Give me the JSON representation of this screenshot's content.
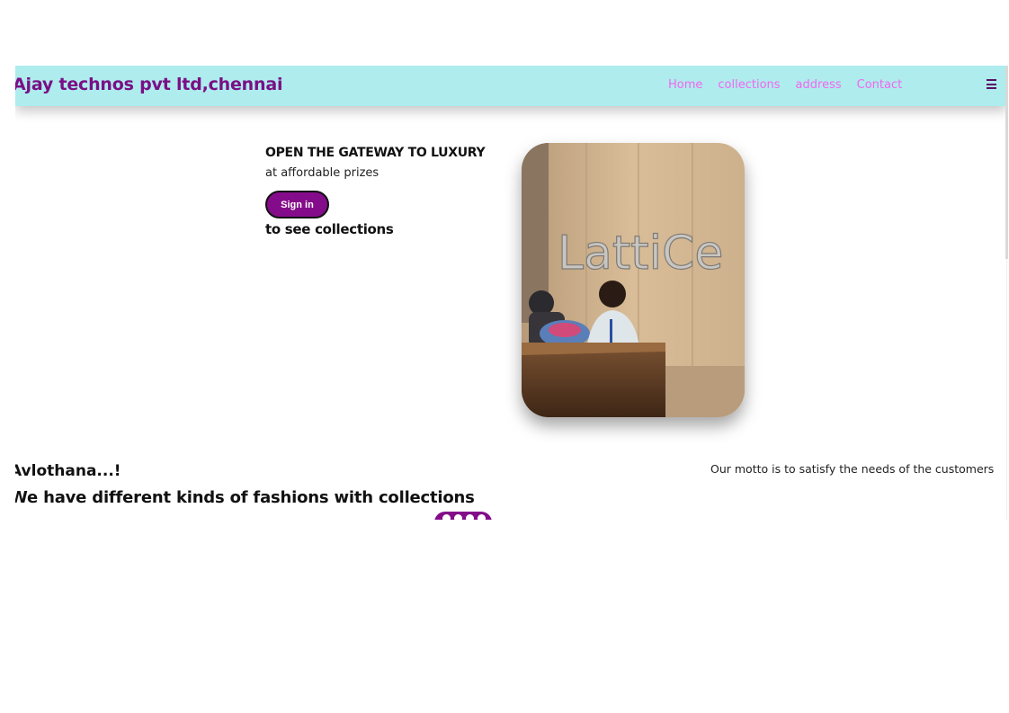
{
  "header": {
    "brand": "Ajay technos pvt ltd,chennai",
    "nav": [
      {
        "label": "Home"
      },
      {
        "label": "collections"
      },
      {
        "label": "address"
      },
      {
        "label": "Contact"
      }
    ],
    "menu_icon": "hamburger-menu-icon"
  },
  "hero": {
    "title": "OPEN THE GATEWAY TO LUXURY",
    "subtitle": "at affordable prizes",
    "signin_label": "Sign in",
    "cta": "to see collections",
    "photo_sign_text": "LattiCe"
  },
  "about": {
    "welcome": "Avlothana...!",
    "fashion": "We have different kinds of fashions with collections",
    "motto": "Our motto is to satisfy the needs of the customers"
  },
  "colors": {
    "navbar_bg": "#aeeced",
    "brand": "#7a0f86",
    "nav_link": "#f266f0",
    "button_bg": "#840c8a"
  }
}
